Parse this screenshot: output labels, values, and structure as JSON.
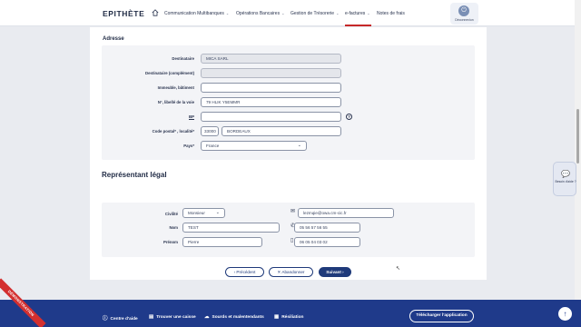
{
  "header": {
    "logo": "EPITHÈTE",
    "nav": [
      {
        "label": "Communication Multibanques",
        "chevron": true
      },
      {
        "label": "Opérations Bancaires",
        "chevron": true
      },
      {
        "label": "Gestion de Trésorerie",
        "chevron": true
      },
      {
        "label": "e-factures",
        "chevron": true,
        "active": true
      },
      {
        "label": "Notes de frais",
        "chevron": false
      }
    ],
    "logout_label": "Déconnexion"
  },
  "address": {
    "title": "Adresse",
    "fields": {
      "destinataire": {
        "label": "Destinataire",
        "value": "MICA SARL"
      },
      "destinataire_complement": {
        "label": "Destinataire (complément)",
        "value": ""
      },
      "immeuble": {
        "label": "Immeuble, bâtiment",
        "value": ""
      },
      "voie": {
        "label": "N°, libellé de la voie",
        "value": "79 HLIK Y5EMMR"
      },
      "bp": {
        "label": "BP",
        "value": ""
      },
      "code_postal": {
        "label": "Code postal* , localité*",
        "value": "33000"
      },
      "localite": {
        "value": "BORDEAUX"
      },
      "pays": {
        "label": "Pays*",
        "value": "France"
      }
    }
  },
  "representant": {
    "title": "Représentant légal",
    "civilite": {
      "label": "Civilité",
      "value": "Monsieur"
    },
    "nom": {
      "label": "Nom",
      "value": "TEST"
    },
    "prenom": {
      "label": "Prénom",
      "value": "Pierre"
    },
    "email": "lezmqie@owa.cm-cic.fr",
    "telephone": "05 56 57 56 55",
    "mobile": "06 05 04 03 02"
  },
  "buttons": {
    "precedent": "Précédent",
    "abandonner": "Abandonner",
    "suivant": "Suivant"
  },
  "help_tab": "Besoin d'aide ?",
  "footer": {
    "links": [
      "Centre d'aide",
      "Trouver une caisse",
      "Sourds et malentendants",
      "Résiliation"
    ],
    "download": "Télécharger l'application"
  },
  "demo_ribbon": "DÉMONSTRATION",
  "colors": {
    "primary": "#1f3a7a",
    "footer": "#1f3a8a",
    "accent": "#c62828"
  }
}
